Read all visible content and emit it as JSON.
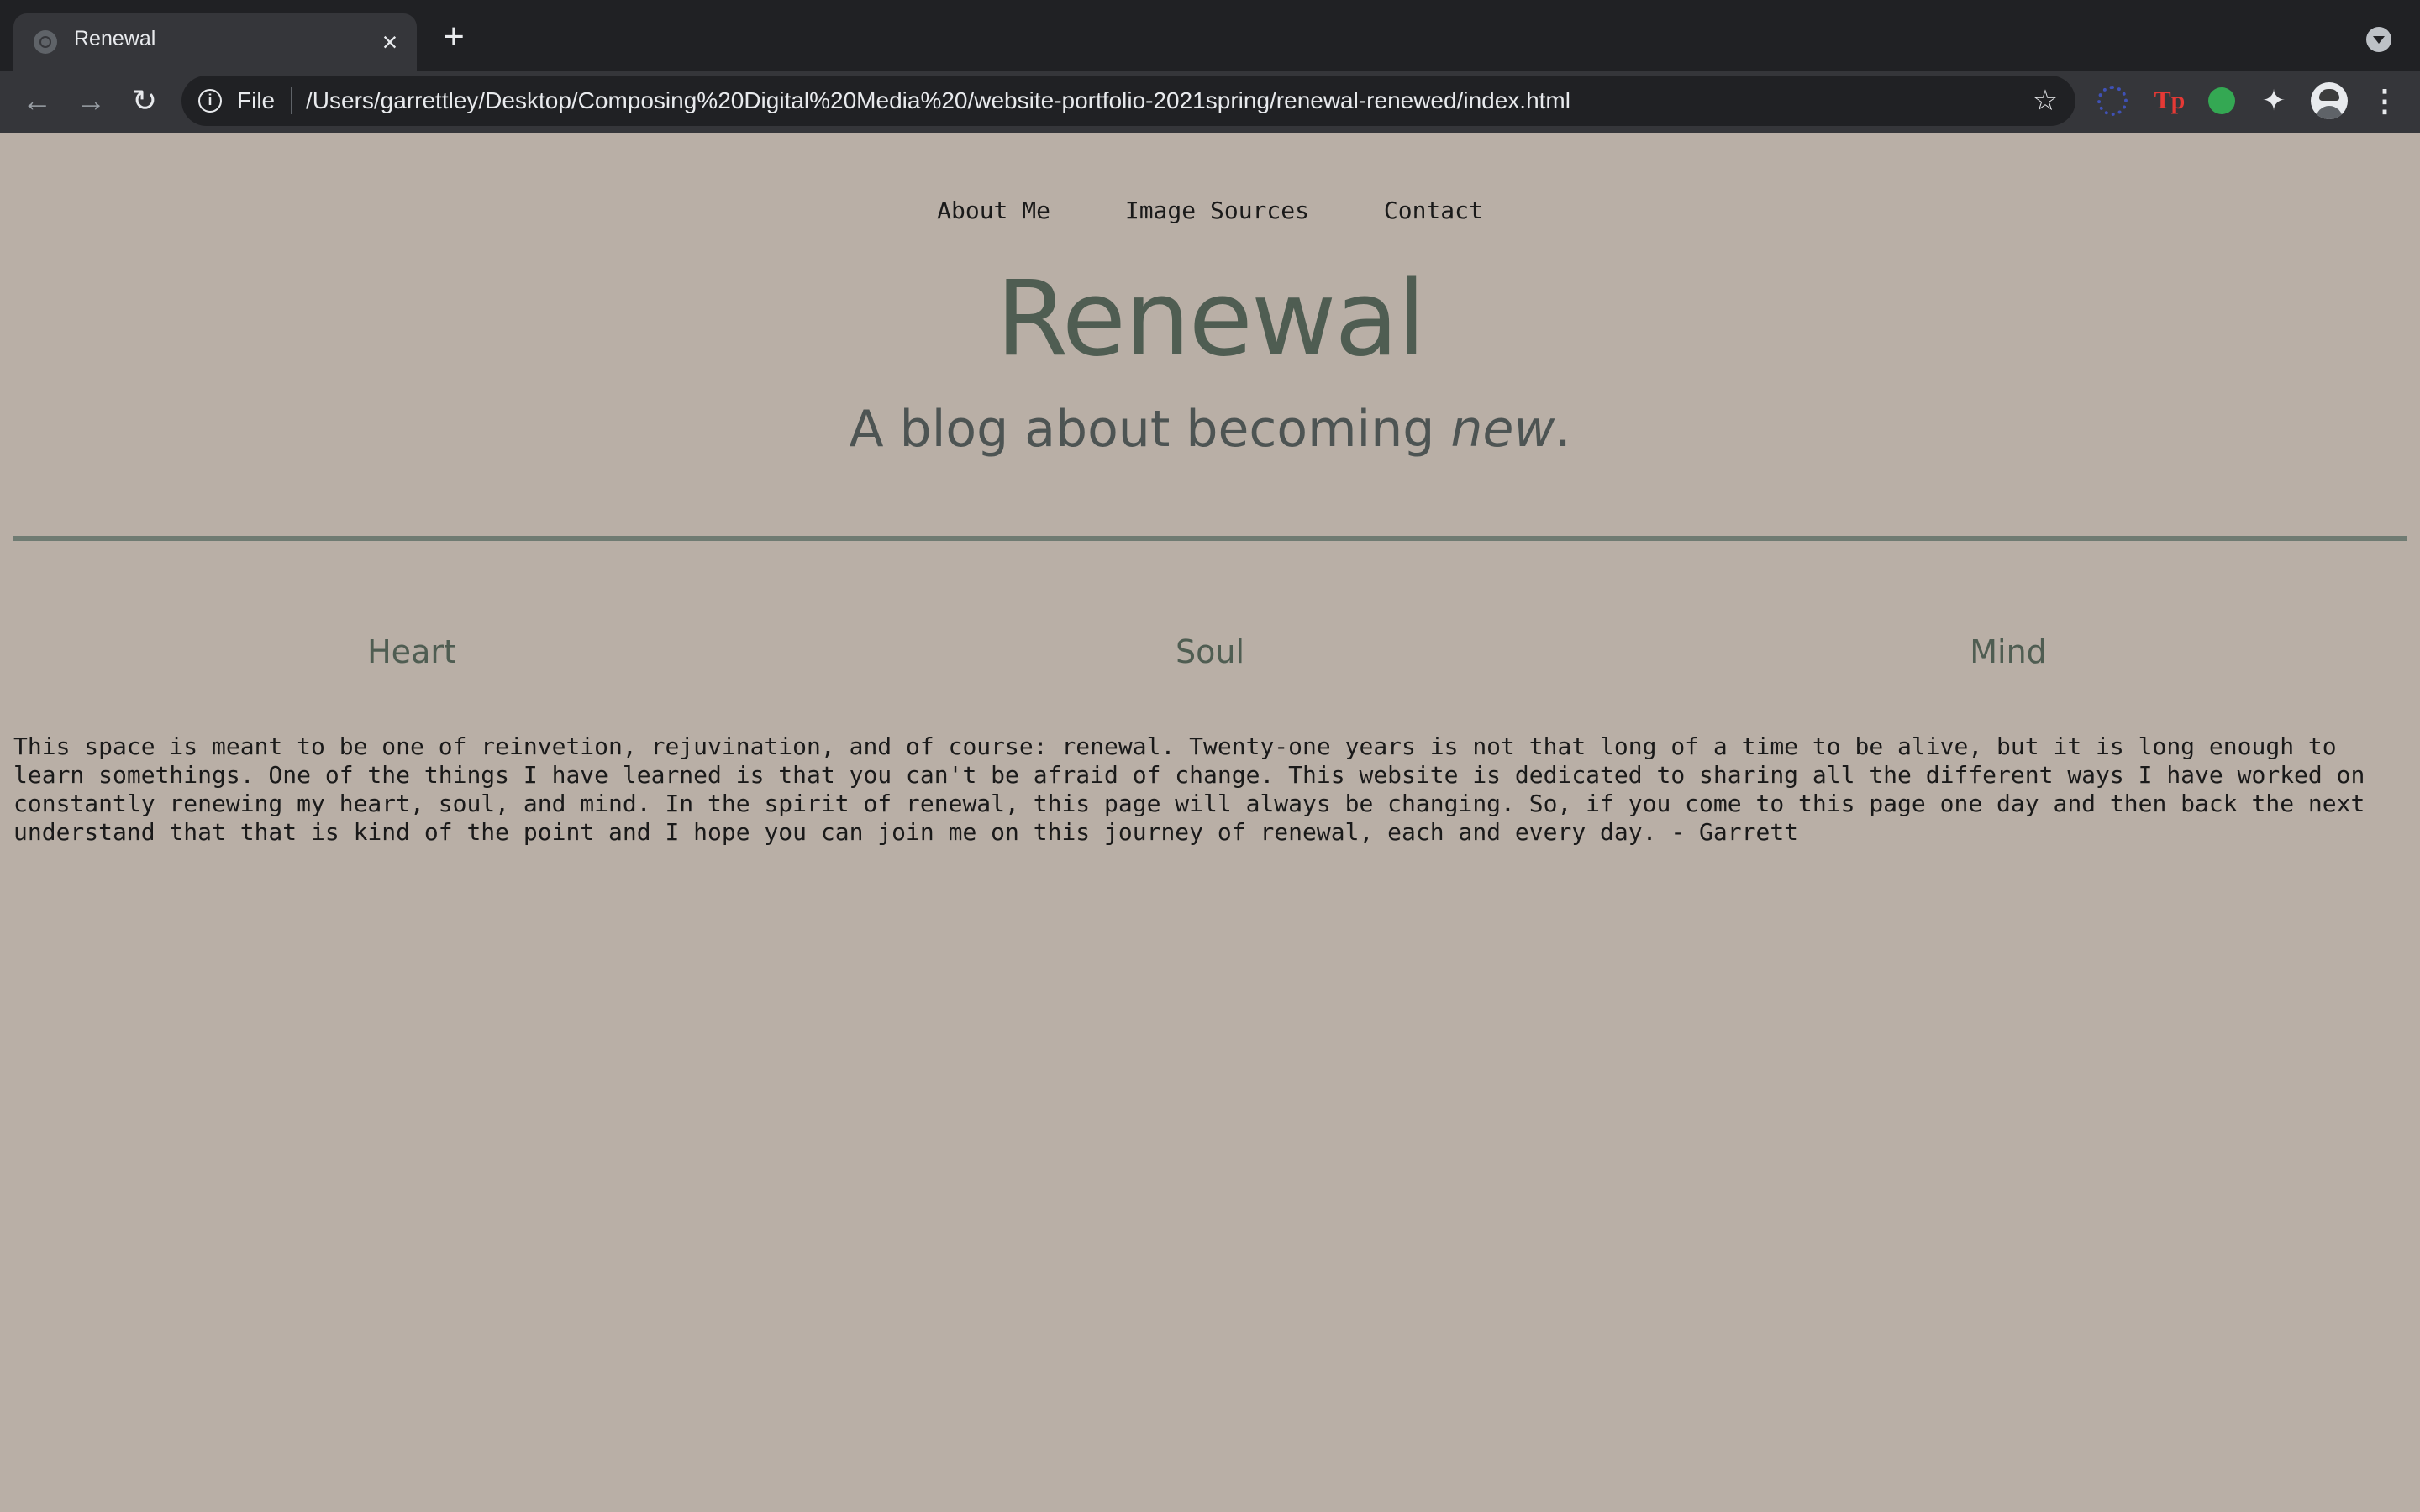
{
  "browser": {
    "tab_title": "Renewal",
    "scheme_label": "File",
    "url": "/Users/garrettley/Desktop/Composing%20Digital%20Media%20/website-portfolio-2021spring/renewal-renewed/index.html",
    "extensions": [
      "circle-extension-icon",
      "tp-extension-icon",
      "green-dot-extension-icon",
      "puzzle-icon"
    ],
    "tp_label": "Tp"
  },
  "nav": {
    "items": [
      "About Me",
      "Image Sources",
      "Contact"
    ]
  },
  "header": {
    "title": "Renewal",
    "tagline_prefix": "A blog about becoming ",
    "tagline_emphasis": "new",
    "tagline_suffix": "."
  },
  "sections": {
    "heart": "Heart",
    "soul": "Soul",
    "mind": "Mind"
  },
  "intro": "This space is meant to be one of reinvetion, rejuvination, and of course: renewal. Twenty-one years is not that long of a time to be alive, but it is long enough to learn somethings. One of the things I have learned is that you can't be afraid of change. This website is dedicated to sharing all the different ways I have worked on constantly renewing my heart, soul, and mind. In the spirit of renewal, this page will always be changing. So, if you come to this page one day and then back the next understand that that is kind of the point and I hope you can join me on this journey of renewal, each and every day. - Garrett",
  "colors": {
    "page_background": "#b9afa6",
    "title_color": "#4f5d52",
    "rule_color": "#6f7b72"
  }
}
